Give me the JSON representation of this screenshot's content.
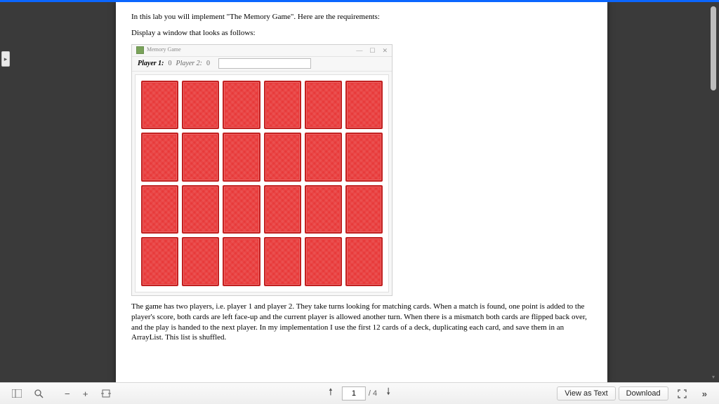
{
  "doc": {
    "intro": "In this lab you will implement \"The Memory Game\". Here are the requirements:",
    "display_line": "Display a window that looks as follows:",
    "window": {
      "title": "Memory Game",
      "player1_label": "Player 1:",
      "player1_score": "0",
      "player2_label": "Player 2:",
      "player2_score": "0",
      "grid_rows": 4,
      "grid_cols": 6
    },
    "rules_para": "The game has two players, i.e. player 1 and player 2. They take turns looking for matching cards. When a match is found, one point is added to the player's score, both cards are left face-up and the current player is allowed another turn. When there is a mismatch both cards are flipped back over, and the play is handed to the next player. In my implementation I use the first 12 cards of a deck, duplicating each card, and save them in an ArrayList. This list is shuffled."
  },
  "footer": {
    "page_current": "1",
    "page_total": "/ 4",
    "view_as_text": "View as Text",
    "download": "Download"
  }
}
